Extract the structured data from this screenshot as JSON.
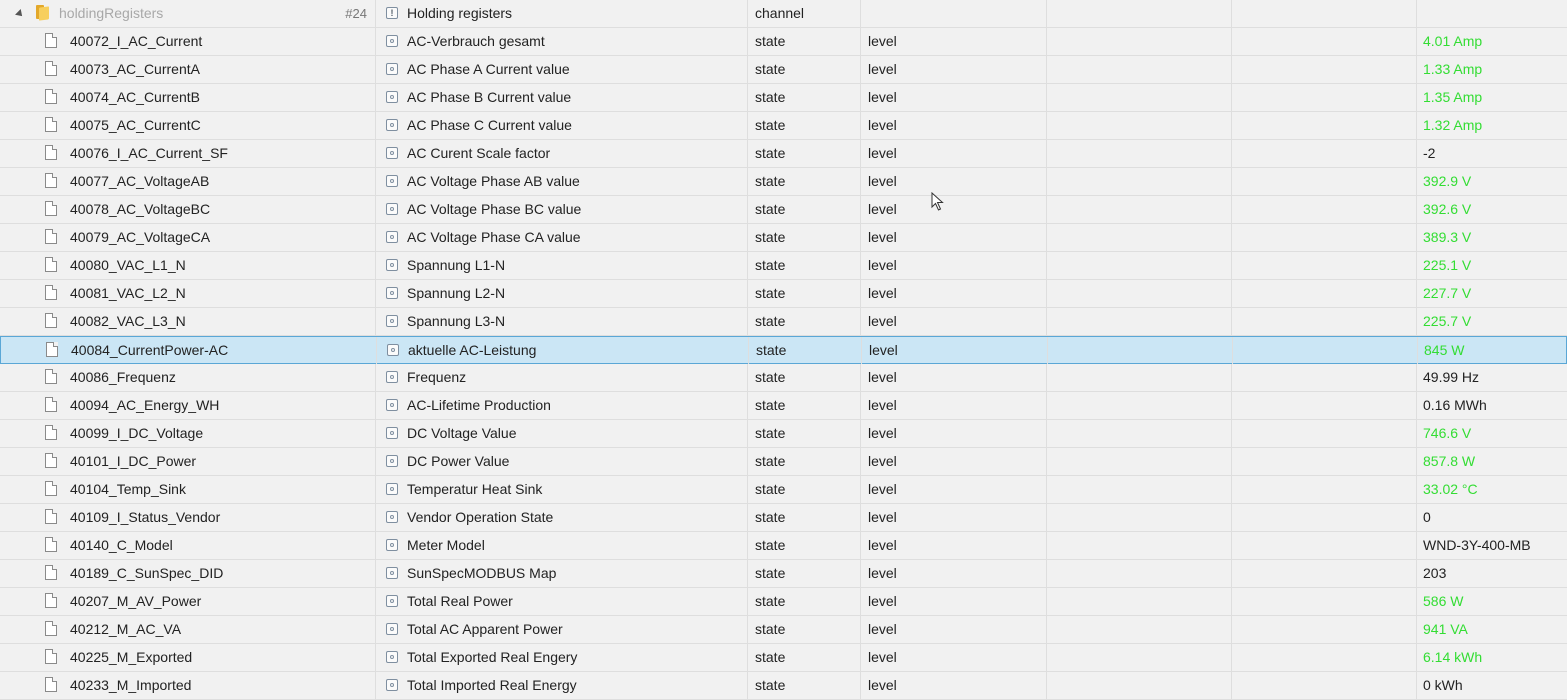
{
  "folder": {
    "id": "holdingRegisters",
    "count": "#24",
    "name": "Holding registers",
    "type": "channel"
  },
  "rows": [
    {
      "id": "40072_I_AC_Current",
      "name": "AC-Verbrauch gesamt",
      "type": "state",
      "role": "level",
      "value": "4.01 Amp",
      "green": true
    },
    {
      "id": "40073_AC_CurrentA",
      "name": "AC Phase A Current value",
      "type": "state",
      "role": "level",
      "value": "1.33 Amp",
      "green": true
    },
    {
      "id": "40074_AC_CurrentB",
      "name": "AC Phase B Current value",
      "type": "state",
      "role": "level",
      "value": "1.35 Amp",
      "green": true
    },
    {
      "id": "40075_AC_CurrentC",
      "name": "AC Phase C Current value",
      "type": "state",
      "role": "level",
      "value": "1.32 Amp",
      "green": true
    },
    {
      "id": "40076_I_AC_Current_SF",
      "name": "AC Curent Scale factor",
      "type": "state",
      "role": "level",
      "value": "-2",
      "green": false
    },
    {
      "id": "40077_AC_VoltageAB",
      "name": "AC Voltage Phase AB value",
      "type": "state",
      "role": "level",
      "value": "392.9 V",
      "green": true
    },
    {
      "id": "40078_AC_VoltageBC",
      "name": "AC Voltage Phase BC value",
      "type": "state",
      "role": "level",
      "value": "392.6 V",
      "green": true
    },
    {
      "id": "40079_AC_VoltageCA",
      "name": "AC Voltage Phase CA value",
      "type": "state",
      "role": "level",
      "value": "389.3 V",
      "green": true
    },
    {
      "id": "40080_VAC_L1_N",
      "name": "Spannung L1-N",
      "type": "state",
      "role": "level",
      "value": "225.1 V",
      "green": true
    },
    {
      "id": "40081_VAC_L2_N",
      "name": "Spannung L2-N",
      "type": "state",
      "role": "level",
      "value": "227.7 V",
      "green": true
    },
    {
      "id": "40082_VAC_L3_N",
      "name": "Spannung L3-N",
      "type": "state",
      "role": "level",
      "value": "225.7 V",
      "green": true
    },
    {
      "id": "40084_CurrentPower-AC",
      "name": "aktuelle AC-Leistung",
      "type": "state",
      "role": "level",
      "value": "845 W",
      "green": true,
      "selected": true
    },
    {
      "id": "40086_Frequenz",
      "name": "Frequenz",
      "type": "state",
      "role": "level",
      "value": "49.99 Hz",
      "green": false
    },
    {
      "id": "40094_AC_Energy_WH",
      "name": "AC-Lifetime Production",
      "type": "state",
      "role": "level",
      "value": "0.16 MWh",
      "green": false
    },
    {
      "id": "40099_I_DC_Voltage",
      "name": "DC Voltage Value",
      "type": "state",
      "role": "level",
      "value": "746.6 V",
      "green": true
    },
    {
      "id": "40101_I_DC_Power",
      "name": "DC Power Value",
      "type": "state",
      "role": "level",
      "value": "857.8 W",
      "green": true
    },
    {
      "id": "40104_Temp_Sink",
      "name": "Temperatur Heat Sink",
      "type": "state",
      "role": "level",
      "value": "33.02 °C",
      "green": true
    },
    {
      "id": "40109_I_Status_Vendor",
      "name": "Vendor Operation State",
      "type": "state",
      "role": "level",
      "value": "0",
      "green": false
    },
    {
      "id": "40140_C_Model",
      "name": "Meter Model",
      "type": "state",
      "role": "level",
      "value": "WND-3Y-400-MB",
      "green": false
    },
    {
      "id": "40189_C_SunSpec_DID",
      "name": "SunSpecMODBUS Map",
      "type": "state",
      "role": "level",
      "value": "203",
      "green": false
    },
    {
      "id": "40207_M_AV_Power",
      "name": "Total Real Power",
      "type": "state",
      "role": "level",
      "value": "586 W",
      "green": true
    },
    {
      "id": "40212_M_AC_VA",
      "name": "Total AC Apparent Power",
      "type": "state",
      "role": "level",
      "value": "941 VA",
      "green": true
    },
    {
      "id": "40225_M_Exported",
      "name": "Total Exported Real Engery",
      "type": "state",
      "role": "level",
      "value": "6.14 kWh",
      "green": true
    },
    {
      "id": "40233_M_Imported",
      "name": "Total Imported Real Energy",
      "type": "state",
      "role": "level",
      "value": "0 kWh",
      "green": false
    }
  ],
  "colors": {
    "value_green": "#33dd33",
    "selected_bg": "#cbe6f5",
    "selected_border": "#5aa7d6"
  }
}
